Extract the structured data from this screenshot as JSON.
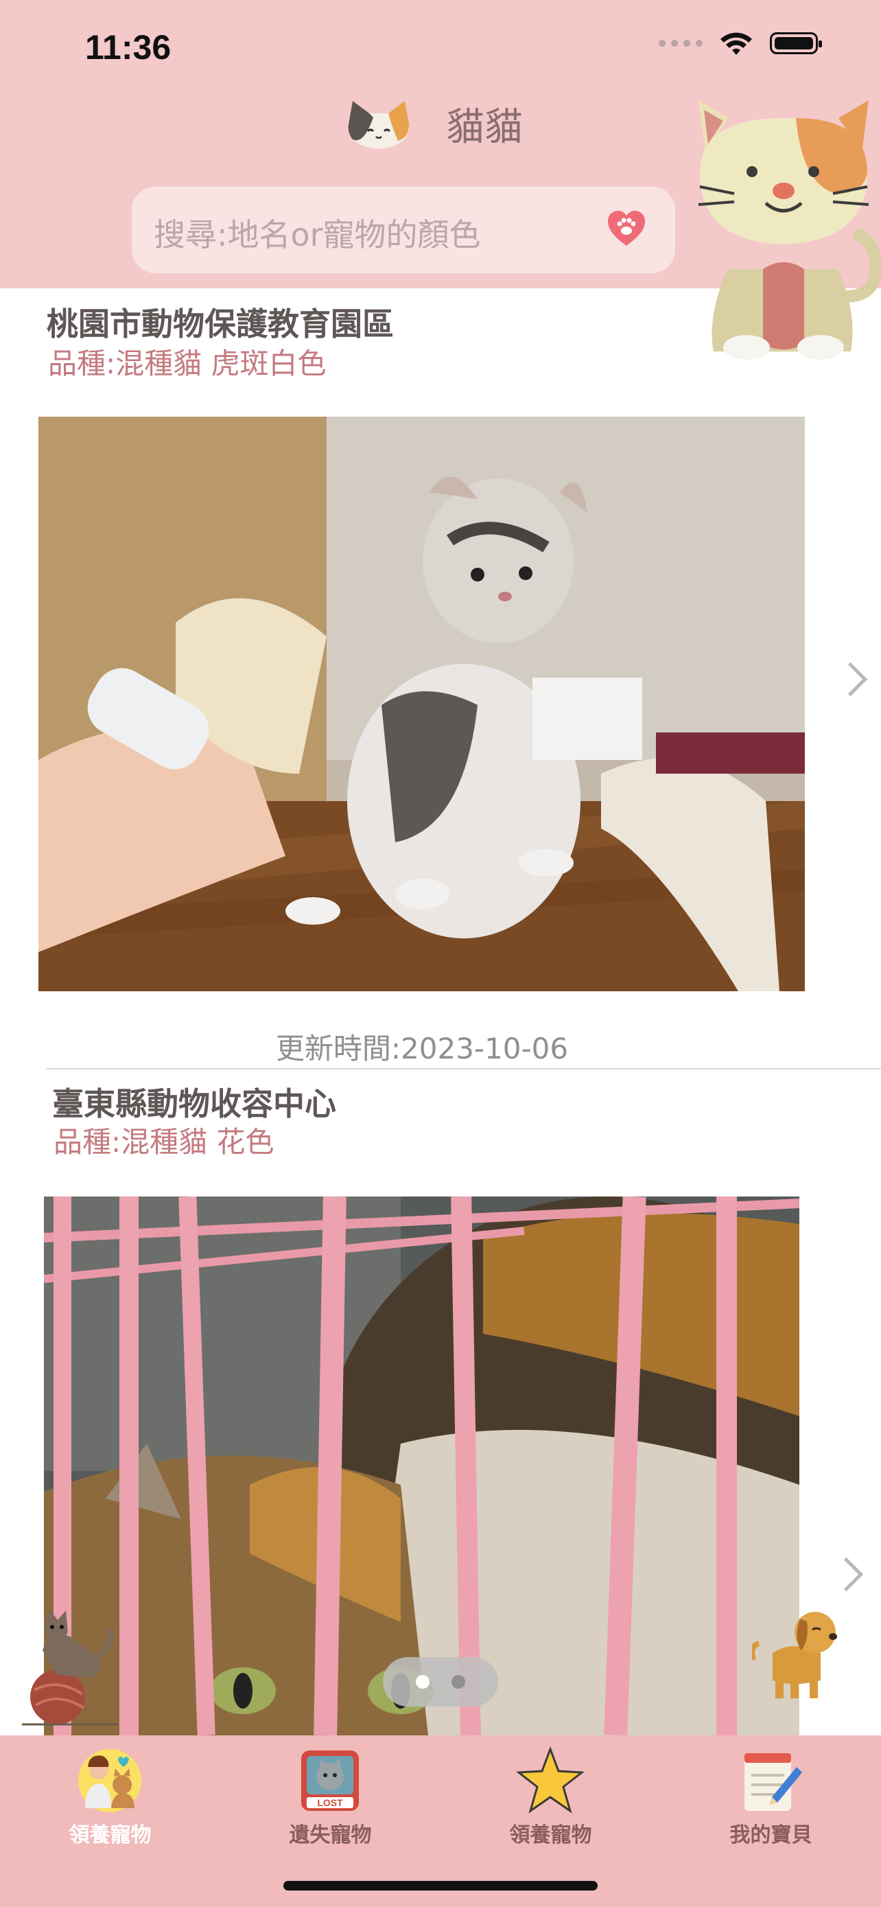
{
  "status_bar": {
    "time": "11:36"
  },
  "nav": {
    "title": "貓貓"
  },
  "search": {
    "placeholder": "搜尋:地名or寵物的顏色"
  },
  "cards": [
    {
      "shelter": "桃園市動物保護教育園區",
      "breed": "品種:混種貓  虎斑白色",
      "updated": "更新時間:2023-10-06"
    },
    {
      "shelter": "臺東縣動物收容中心",
      "breed": "品種:混種貓  花色"
    }
  ],
  "pager": {
    "total": 2,
    "current": 1
  },
  "tabbar": {
    "tabs": [
      {
        "label": "領養寵物",
        "icon": "adopt-pets-icon",
        "selected": true
      },
      {
        "label": "遺失寵物",
        "icon": "lost-pet-icon",
        "selected": false
      },
      {
        "label": "領養寵物",
        "icon": "star-icon",
        "selected": false
      },
      {
        "label": "我的寶貝",
        "icon": "notepad-icon",
        "selected": false
      }
    ]
  },
  "colors": {
    "header_bg": "#f4c9ca",
    "tabbar_bg": "#f1bbbb",
    "accent": "#c47b80",
    "selected_tab": "#ffffff",
    "unselected_tab": "#8a5d5d"
  }
}
